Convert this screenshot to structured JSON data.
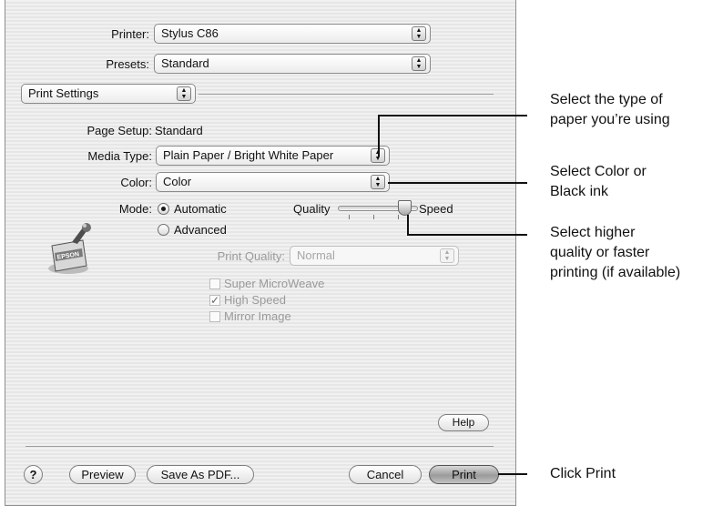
{
  "printer": {
    "label": "Printer:",
    "value": "Stylus C86"
  },
  "presets": {
    "label": "Presets:",
    "value": "Standard"
  },
  "panel": {
    "value": "Print Settings"
  },
  "page_setup": {
    "label": "Page Setup:",
    "value": "Standard"
  },
  "media_type": {
    "label": "Media Type:",
    "value": "Plain Paper / Bright White Paper"
  },
  "color": {
    "label": "Color:",
    "value": "Color"
  },
  "mode": {
    "label": "Mode:",
    "automatic": "Automatic",
    "advanced": "Advanced",
    "selected": "Automatic",
    "slider_left": "Quality",
    "slider_right": "Speed",
    "slider_position": 0.85
  },
  "print_quality": {
    "label": "Print Quality:",
    "value": "Normal"
  },
  "options": [
    {
      "label": "Super MicroWeave",
      "checked": false
    },
    {
      "label": "High Speed",
      "checked": true
    },
    {
      "label": "Mirror Image",
      "checked": false
    }
  ],
  "logo": {
    "text": "EPSON"
  },
  "buttons": {
    "help": "Help",
    "question": "?",
    "preview": "Preview",
    "save_pdf": "Save As PDF...",
    "cancel": "Cancel",
    "print": "Print"
  },
  "callouts": {
    "media_1": "Select the type of",
    "media_2": "paper you’re using",
    "color_1": "Select Color or",
    "color_2": "Black ink",
    "mode_1": "Select higher",
    "mode_2": "quality or faster",
    "mode_3": "printing (if available)",
    "print": "Click Print"
  },
  "icons": {
    "popup_arrows": "updown-arrows-icon",
    "checkmark": "checkmark-icon",
    "logo": "epson-printer-logo-icon"
  }
}
